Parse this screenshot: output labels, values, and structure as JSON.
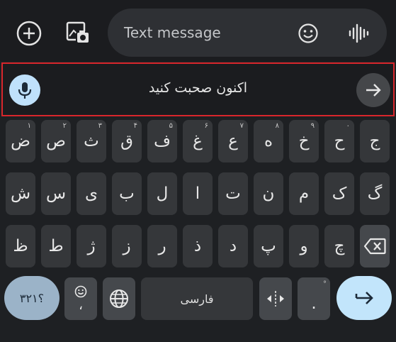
{
  "compose": {
    "placeholder": "Text message",
    "add_icon": "plus-circle-icon",
    "gallery_icon": "gallery-icon",
    "emoji_icon": "emoji-icon",
    "voice_icon": "voice-wave-icon"
  },
  "suggestion": {
    "speak_text": "اکنون صحبت کنید",
    "mic_icon": "mic-icon",
    "send_icon": "arrow-right-icon"
  },
  "keyboard": {
    "row1": [
      {
        "label": "ض",
        "hint": "۱"
      },
      {
        "label": "ص",
        "hint": "۲"
      },
      {
        "label": "ث",
        "hint": "۳"
      },
      {
        "label": "ق",
        "hint": "۴"
      },
      {
        "label": "ف",
        "hint": "۵"
      },
      {
        "label": "غ",
        "hint": "۶"
      },
      {
        "label": "ع",
        "hint": "۷"
      },
      {
        "label": "ه",
        "hint": "۸"
      },
      {
        "label": "خ",
        "hint": "۹"
      },
      {
        "label": "ح",
        "hint": "۰"
      },
      {
        "label": "ج",
        "hint": ""
      }
    ],
    "row2": [
      "ش",
      "س",
      "ی",
      "ب",
      "ل",
      "ا",
      "ت",
      "ن",
      "م",
      "ک",
      "گ"
    ],
    "row3": [
      "ظ",
      "ط",
      "ژ",
      "ز",
      "ر",
      "ذ",
      "د",
      "پ",
      "و",
      "چ"
    ],
    "number_key": "؟۳۲۱",
    "comma_key": "،",
    "space_label": "فارسی",
    "period_key": ".",
    "colors": {
      "accent": "#c2e5fb",
      "number_key": "#9bb3c8",
      "highlight_border": "#d9262c"
    }
  }
}
